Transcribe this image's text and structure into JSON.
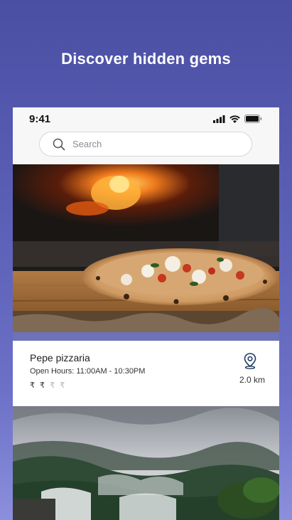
{
  "promo": {
    "title": "Discover hidden gems"
  },
  "status_bar": {
    "time": "9:41"
  },
  "search": {
    "placeholder": "Search"
  },
  "places": [
    {
      "name": "Pepe pizzaria",
      "hours": "Open Hours: 11:00AM - 10:30PM",
      "price_symbols_active": "₹ ₹",
      "price_symbols_inactive": " ₹ ₹",
      "price_level": 2,
      "price_max": 4,
      "distance": "2.0 km",
      "image": "pizza-photo"
    },
    {
      "image": "waterfall-photo"
    }
  ],
  "colors": {
    "background_top": "#4b4fa3",
    "background_bottom": "#8b8fdc",
    "card": "#ffffff",
    "accent_pin": "#1f3a5f"
  }
}
